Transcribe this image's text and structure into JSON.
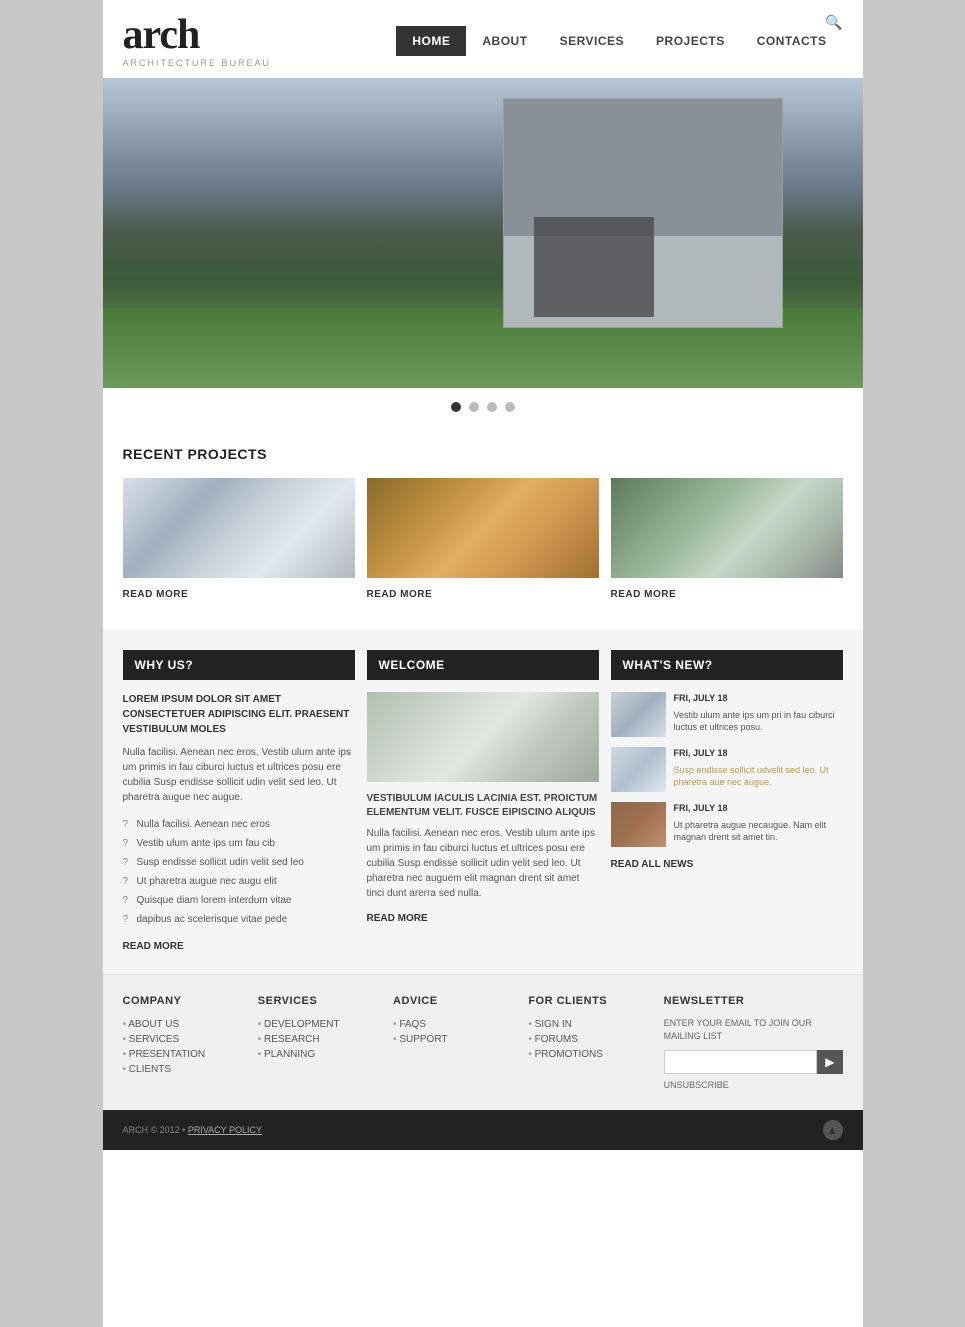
{
  "site": {
    "logo_text": "arch",
    "logo_sub": "ARCHITECTURE BUREAU",
    "tagline": "ARCHITECTURE BUREAU"
  },
  "nav": {
    "items": [
      {
        "label": "HOME",
        "active": true
      },
      {
        "label": "ABOUT",
        "active": false
      },
      {
        "label": "SERVICES",
        "active": false
      },
      {
        "label": "PROJECTS",
        "active": false
      },
      {
        "label": "CONTACTS",
        "active": false
      }
    ]
  },
  "slider": {
    "dots": [
      1,
      2,
      3,
      4
    ]
  },
  "recent_projects": {
    "title": "RECENT PROJECTS",
    "items": [
      {
        "read_more": "READ MORE"
      },
      {
        "read_more": "READ MORE"
      },
      {
        "read_more": "READ MORE"
      }
    ]
  },
  "why_us": {
    "header": "WHY US?",
    "title": "LOREM IPSUM DOLOR SIT AMET CONSECTETUER ADIPISCING ELIT. PRAESENT VESTIBULUM MOLES",
    "body": "Nulla facilisi. Aenean nec eros. Vestib ulum ante ips um primis in fau ciburci luctus et ultrices posu ere cubilia Susp endisse sollicit udin velit sed leo. Ut pharetra augue nec augue.",
    "list": [
      "Nulla facilisi. Aenean nec eros",
      "Vestib ulum ante ips um fau cib",
      "Susp endisse sollicit udin velit sed leo",
      "Ut pharetra augue nec augu elit",
      "Quisque diam lorem interdum vitae",
      "dapibus ac scelerisque vitae pede"
    ],
    "read_more": "READ MORE"
  },
  "welcome": {
    "header": "WELCOME",
    "body_title": "VESTIBULUM IACULIS LACINIA EST. PROICTUM ELEMENTUM VELIT. FUSCE EIPISCINO ALIQUIS",
    "body": "Nulla facilisi. Aenean nec eros. Vestib ulum ante ips um primis in fau ciburci luctus et ultrices posu ere cubilia Susp endisse sollicit udin velit sed leo. Ut pharetra nec auguem elit magnan drent sit amet tinci dunt arerra sed nulla.",
    "read_more": "READ MORE"
  },
  "whats_new": {
    "header": "WHAT'S NEW?",
    "items": [
      {
        "date": "FRI, JULY 18",
        "text": "Vestib ulum ante ips um pri in fau ciburci luctus et ultrices posu.",
        "highlight": false
      },
      {
        "date": "FRI, JULY 18",
        "text": "Susp endisse sollicit udvelit sed leo. Ut pharetra aue nec augue.",
        "highlight": true
      },
      {
        "date": "FRI, JULY 18",
        "text": "Ut pharetra augue necaugue. Nam elit magnan drent sit amet tin.",
        "highlight": false
      }
    ],
    "read_all": "READ ALL NEWS"
  },
  "footer": {
    "company": {
      "title": "COMPANY",
      "links": [
        "ABOUT US",
        "SERVICES",
        "PRESENTATION",
        "CLIENTS"
      ]
    },
    "services": {
      "title": "SERVICES",
      "links": [
        "DEVELOPMENT",
        "RESEARCH",
        "PLANNING"
      ]
    },
    "advice": {
      "title": "ADVICE",
      "links": [
        "FAQS",
        "SUPPORT"
      ]
    },
    "for_clients": {
      "title": "FOR CLIENTS",
      "links": [
        "SIGN IN",
        "FORUMS",
        "PROMOTIONS"
      ]
    },
    "newsletter": {
      "title": "NEWSLETTER",
      "description": "ENTER YOUR EMAIL TO JOIN OUR MAILING LIST",
      "input_placeholder": "",
      "btn_label": "▶",
      "unsubscribe": "UNSUBSCRIBE"
    },
    "bottom": {
      "copy": "ARCH © 2012 •",
      "policy": "PRIVACY POLICY"
    }
  }
}
